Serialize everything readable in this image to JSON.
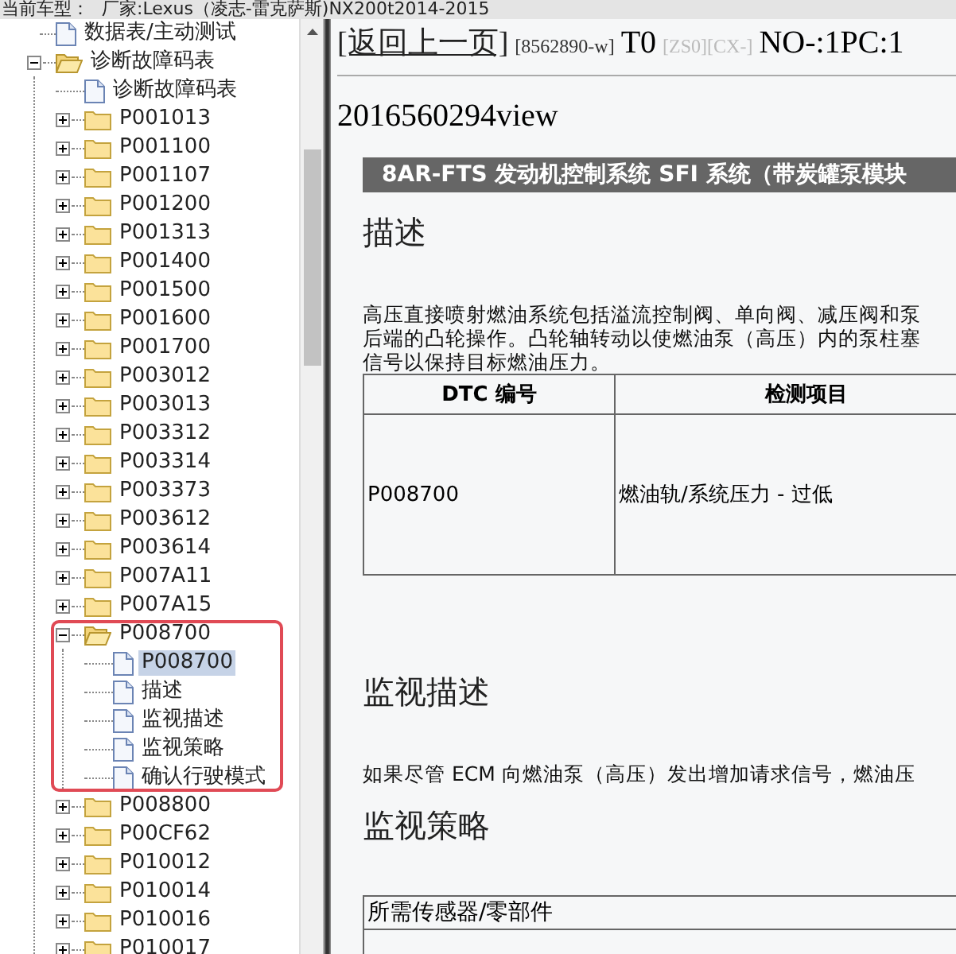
{
  "top_bar": {
    "label": "当前车型：",
    "vehicle": "厂家:Lexus（凌志-雷克萨斯)NX200t2014-2015"
  },
  "tree": [
    {
      "label": "数据表/主动测试",
      "kind": "doc",
      "selected": false
    },
    {
      "label": "诊断故障码表",
      "kind": "folder",
      "expanded": true,
      "children": [
        {
          "label": "诊断故障码表",
          "kind": "doc",
          "selected": false
        },
        {
          "label": "P001013",
          "kind": "folder",
          "expanded": false
        },
        {
          "label": "P001100",
          "kind": "folder",
          "expanded": false
        },
        {
          "label": "P001107",
          "kind": "folder",
          "expanded": false
        },
        {
          "label": "P001200",
          "kind": "folder",
          "expanded": false
        },
        {
          "label": "P001313",
          "kind": "folder",
          "expanded": false
        },
        {
          "label": "P001400",
          "kind": "folder",
          "expanded": false
        },
        {
          "label": "P001500",
          "kind": "folder",
          "expanded": false
        },
        {
          "label": "P001600",
          "kind": "folder",
          "expanded": false
        },
        {
          "label": "P001700",
          "kind": "folder",
          "expanded": false
        },
        {
          "label": "P003012",
          "kind": "folder",
          "expanded": false
        },
        {
          "label": "P003013",
          "kind": "folder",
          "expanded": false
        },
        {
          "label": "P003312",
          "kind": "folder",
          "expanded": false
        },
        {
          "label": "P003314",
          "kind": "folder",
          "expanded": false
        },
        {
          "label": "P003373",
          "kind": "folder",
          "expanded": false
        },
        {
          "label": "P003612",
          "kind": "folder",
          "expanded": false
        },
        {
          "label": "P003614",
          "kind": "folder",
          "expanded": false
        },
        {
          "label": "P007A11",
          "kind": "folder",
          "expanded": false
        },
        {
          "label": "P007A15",
          "kind": "folder",
          "expanded": false
        },
        {
          "label": "P008700",
          "kind": "folder",
          "expanded": true,
          "highlighted": true,
          "children": [
            {
              "label": "P008700",
              "kind": "doc",
              "selected": true
            },
            {
              "label": "描述",
              "kind": "doc",
              "selected": false
            },
            {
              "label": "监视描述",
              "kind": "doc",
              "selected": false
            },
            {
              "label": "监视策略",
              "kind": "doc",
              "selected": false
            },
            {
              "label": "确认行驶模式",
              "kind": "doc",
              "selected": false
            }
          ]
        },
        {
          "label": "P008800",
          "kind": "folder",
          "expanded": false
        },
        {
          "label": "P00CF62",
          "kind": "folder",
          "expanded": false
        },
        {
          "label": "P010012",
          "kind": "folder",
          "expanded": false
        },
        {
          "label": "P010014",
          "kind": "folder",
          "expanded": false
        },
        {
          "label": "P010016",
          "kind": "folder",
          "expanded": false
        },
        {
          "label": "P010017",
          "kind": "folder",
          "expanded": false
        }
      ]
    }
  ],
  "nav": {
    "back_link": "[返回上一页]",
    "code": "[8562890-w]",
    "t": "T0",
    "tags": "[ZS0][CX-]",
    "page": "NO-:1PC:1"
  },
  "doc_id": "2016560294view",
  "banner": "8AR-FTS 发动机控制系统  SFI 系统（带炭罐泵模块",
  "sections": [
    {
      "heading": "描述",
      "paragraphs": [
        "高压直接喷射燃油系统包括溢流控制阀、单向阀、减压阀和泵",
        "后端的凸轮操作。凸轮轴转动以使燃油泵（高压）内的泵柱塞",
        "信号以保持目标燃油压力。"
      ],
      "table": {
        "kind": "dtc",
        "columns": [
          "DTC 编号",
          "检测项目"
        ],
        "rows": [
          [
            "P008700",
            "燃油轨/系统压力 - 过低"
          ]
        ]
      }
    },
    {
      "heading": "监视描述",
      "paragraphs": [
        "如果尽管 ECM 向燃油泵（高压）发出增加请求信号，燃油压"
      ]
    },
    {
      "heading": "监视策略",
      "table": {
        "kind": "strategy",
        "rows": [
          [
            "所需传感器/零部件"
          ],
          []
        ]
      }
    }
  ]
}
